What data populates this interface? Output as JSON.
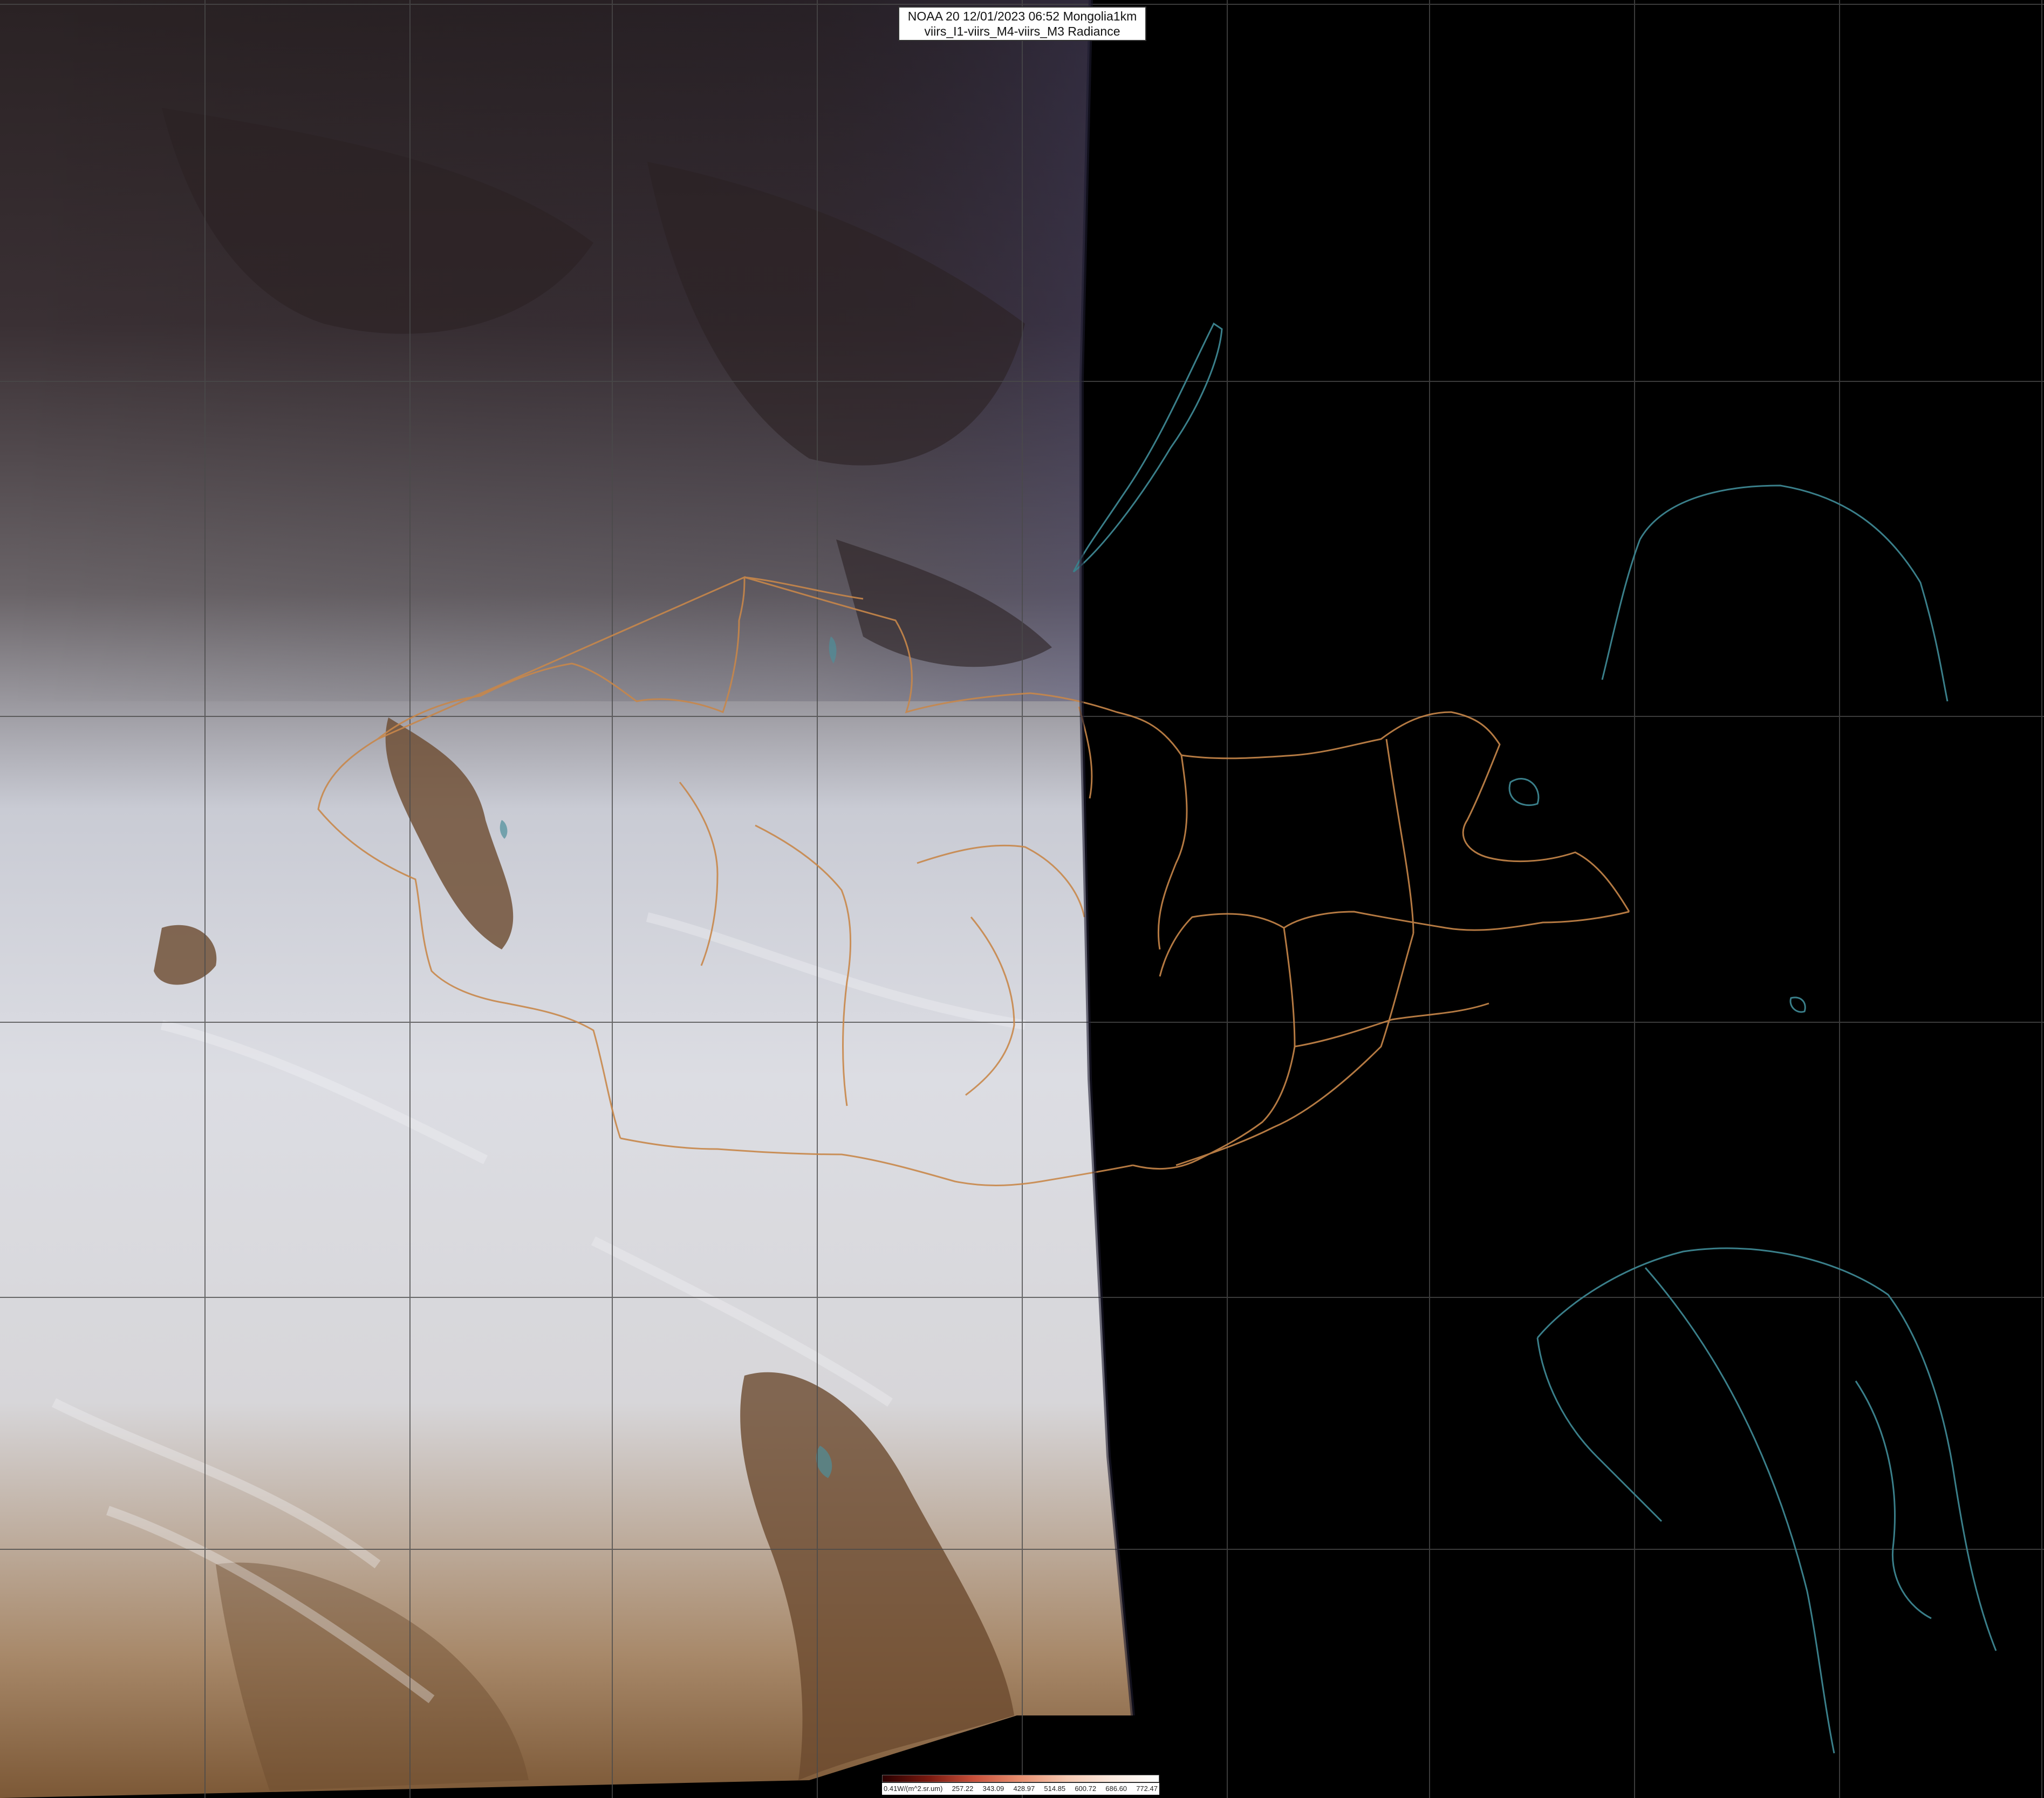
{
  "header": {
    "line1": "NOAA 20 12/01/2023 06:52 Mongolia1km",
    "line2": "viirs_I1-viirs_M4-viirs_M3 Radiance"
  },
  "colorbar": {
    "labels": [
      "0.41W/(m^2.sr.um)",
      "257.22",
      "343.09",
      "428.97",
      "514.85",
      "600.72",
      "686.60",
      "772.47"
    ],
    "palette": [
      "#2a0000",
      "#7a1a10",
      "#c8503a",
      "#e89070",
      "#f6c9b2",
      "#fbe9de",
      "#ffffff"
    ]
  },
  "map_style": {
    "background": "#000000",
    "graticule": "#4a4a4a",
    "province_borders": "#c8874a",
    "coastline": "#3a7f8a",
    "snow_cloud": "#e8e9ee",
    "bare_ground": "#6e4a2c",
    "night_side": "#000000"
  }
}
